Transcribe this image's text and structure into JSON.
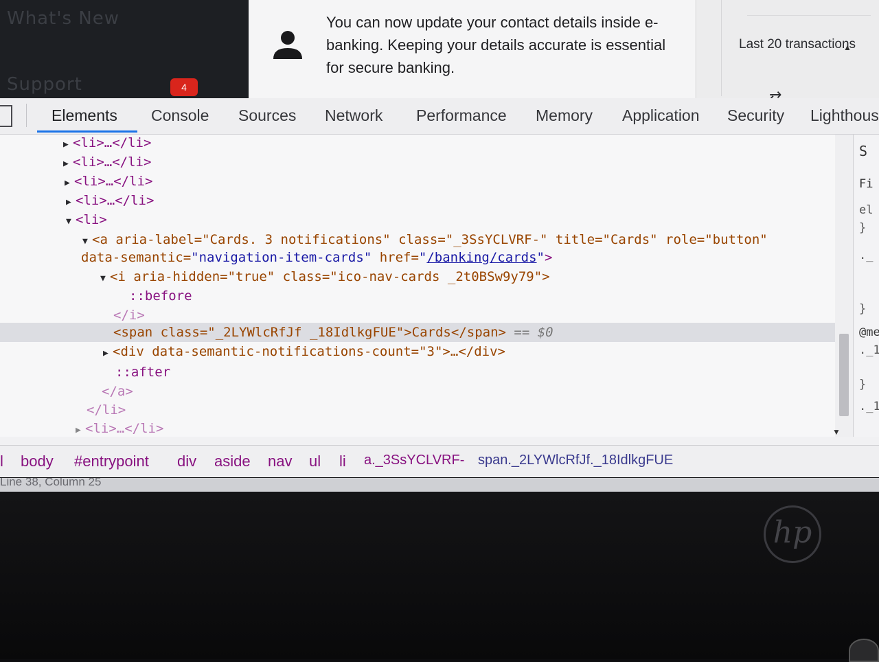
{
  "page": {
    "nav": {
      "whats_new": "What's New",
      "support": "Support",
      "support_badge": "4"
    },
    "notice": {
      "icon": "person-icon",
      "text": "You can now update your contact details inside e-banking. Keeping your details accurate is essential for secure banking."
    },
    "right": {
      "last_transactions": "Last 20 transactions",
      "swap_icon": "⇄"
    }
  },
  "devtools": {
    "tabs": [
      "Elements",
      "Console",
      "Sources",
      "Network",
      "Performance",
      "Memory",
      "Application",
      "Security",
      "Lighthouse"
    ],
    "active_tab": "Elements",
    "dom": {
      "li_collapsed": "<li>…</li>",
      "li_open": "<li>",
      "a_open_1": "<a aria-label=\"Cards. 3 notifications\" class=\"_3SsYCLVRF-\" title=\"Cards\" role=\"button\"",
      "a_open_2_attr": "data-semantic=",
      "a_open_2_val": "\"navigation-item-cards\"",
      "a_open_2_href": " href=",
      "a_open_2_link": "/banking/cards",
      "i_open": "<i aria-hidden=\"true\" class=\"ico-nav-cards _2t0BSw9y79\">",
      "before": "::before",
      "i_close": "</i>",
      "span": "<span class=\"_2LYWlcRfJf _18IdlkgFUE\">Cards</span>",
      "span_marker": "== $0",
      "div": "<div data-semantic-notifications-count=\"3\">…</div>",
      "after": "::after",
      "a_close": "</a>",
      "li_close": "</li>"
    },
    "styles_pane": [
      "S",
      "Fi",
      "el",
      "}",
      "._",
      "}",
      "@me",
      "._1",
      "}",
      "._1"
    ],
    "breadcrumbs": [
      "l",
      "body",
      "#entrypoint",
      "div",
      "aside",
      "nav",
      "ul",
      "li",
      "a._3SsYCLVRF-",
      "span._2LYWlcRfJf._18IdlkgFUE"
    ]
  },
  "status_bar": "Line 38, Column 25",
  "bezel": {
    "logo": "hp"
  }
}
